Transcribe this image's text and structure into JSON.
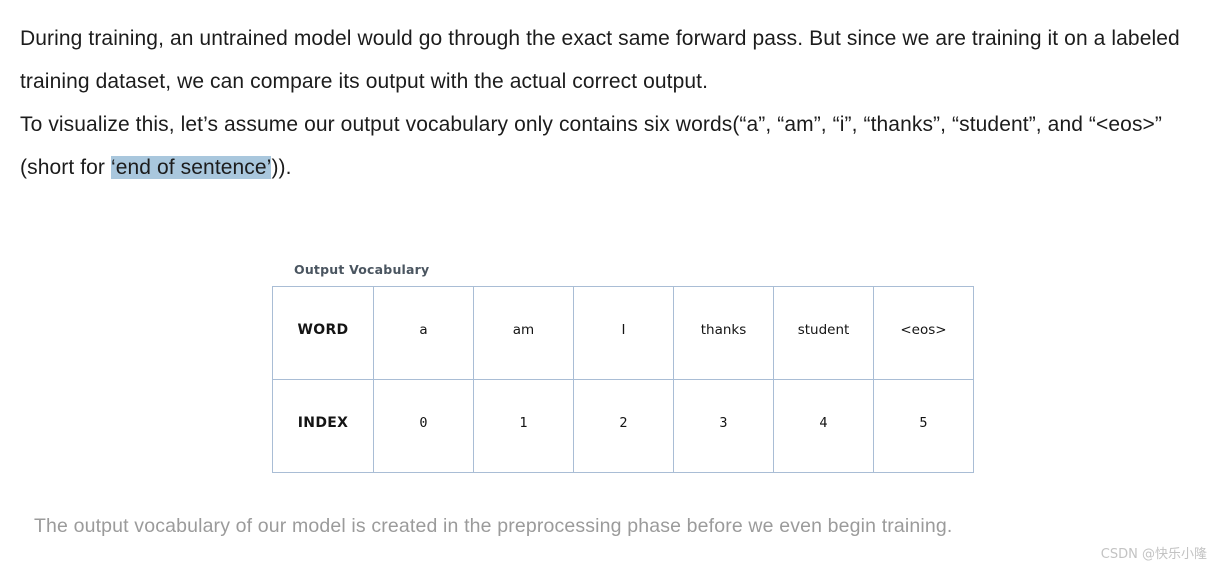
{
  "article": {
    "paragraph1_part1": "During training, an untrained model would go through the exact same forward pass. But since we are training it on a labeled training dataset, we can compare its output with the actual correct output.",
    "paragraph2_before_highlight": "To visualize this, let’s assume our output vocabulary only contains six words(“a”, “am”, “i”, “thanks”, “student”, and “<eos>” (short for ",
    "paragraph2_highlight": "‘end of sentence’",
    "paragraph2_after_highlight": ")).",
    "highlight_color": "#a9c7dd"
  },
  "figure": {
    "title": "Output Vocabulary",
    "table": {
      "border_color": "#a9bdd5",
      "rows": [
        {
          "header": "WORD",
          "cells": [
            "a",
            "am",
            "I",
            "thanks",
            "student",
            "<eos>"
          ]
        },
        {
          "header": "INDEX",
          "cells": [
            "0",
            "1",
            "2",
            "3",
            "4",
            "5"
          ]
        }
      ]
    }
  },
  "caption": {
    "text": "The output vocabulary of our model is created in the preprocessing phase before we even begin training.",
    "color": "#9b9b9b"
  },
  "watermark": {
    "text": "CSDN @快乐小隆"
  }
}
